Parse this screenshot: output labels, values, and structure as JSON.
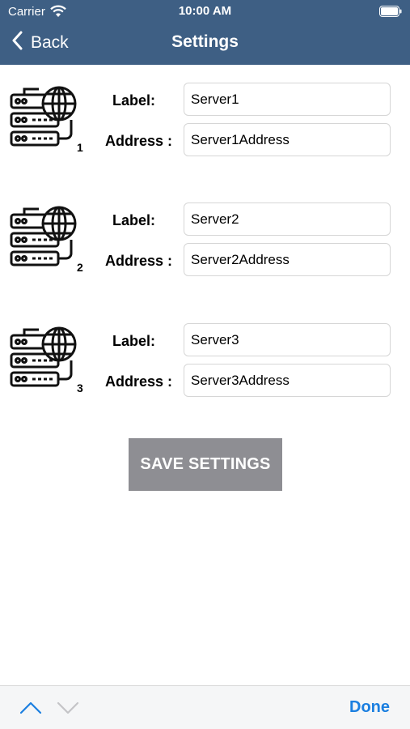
{
  "status_bar": {
    "carrier": "Carrier",
    "time": "10:00 AM"
  },
  "nav": {
    "back_label": "Back",
    "title": "Settings"
  },
  "servers": [
    {
      "number": "1",
      "label_caption": "Label:",
      "address_caption": "Address :",
      "label_value": "Server1",
      "address_value": "Server1Address"
    },
    {
      "number": "2",
      "label_caption": "Label:",
      "address_caption": "Address :",
      "label_value": "Server2",
      "address_value": "Server2Address"
    },
    {
      "number": "3",
      "label_caption": "Label:",
      "address_caption": "Address :",
      "label_value": "Server3",
      "address_value": "Server3Address"
    }
  ],
  "save_button": {
    "label": "SAVE SETTINGS"
  },
  "keyboard_toolbar": {
    "done_label": "Done"
  },
  "colors": {
    "nav_bg": "#3e5f84",
    "save_bg": "#8e8e93",
    "done": "#1b7fe0"
  },
  "icons": [
    "wifi-icon",
    "battery-icon",
    "chevron-left-icon",
    "server-globe-icon",
    "chevron-up-icon",
    "chevron-down-icon"
  ]
}
